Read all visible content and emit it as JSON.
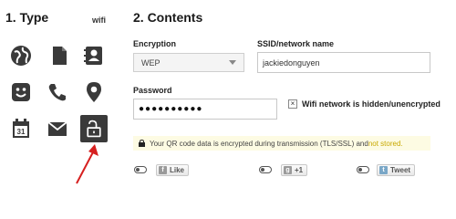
{
  "type_panel": {
    "title": "1. Type",
    "wifi_tag": "wifi",
    "icons": [
      "globe-icon",
      "document-icon",
      "contact-card-icon",
      "smiley-icon",
      "phone-icon",
      "map-pin-icon",
      "calendar-icon",
      "envelope-icon",
      "unlock-icon"
    ],
    "calendar_day": "31",
    "selected": "unlock-icon"
  },
  "contents": {
    "title": "2. Contents",
    "encryption": {
      "label": "Encryption",
      "value": "WEP"
    },
    "ssid": {
      "label": "SSID/network name",
      "value": "jackiedonguyen"
    },
    "password": {
      "label": "Password",
      "value": "●●●●●●●●●●"
    },
    "hidden": {
      "label": "Wifi network is hidden/unencrypted",
      "mark": "×"
    },
    "notice": {
      "text": "Your QR code data is encrypted during transmission (TLS/SSL) and ",
      "highlight": "not stored."
    }
  },
  "social": {
    "like": "Like",
    "plus": "+1",
    "tweet": "Tweet"
  },
  "colors": {
    "accent_arrow": "#d62020",
    "notice_bg": "#fdfbe3",
    "selected_bg": "#3a3a3a"
  }
}
